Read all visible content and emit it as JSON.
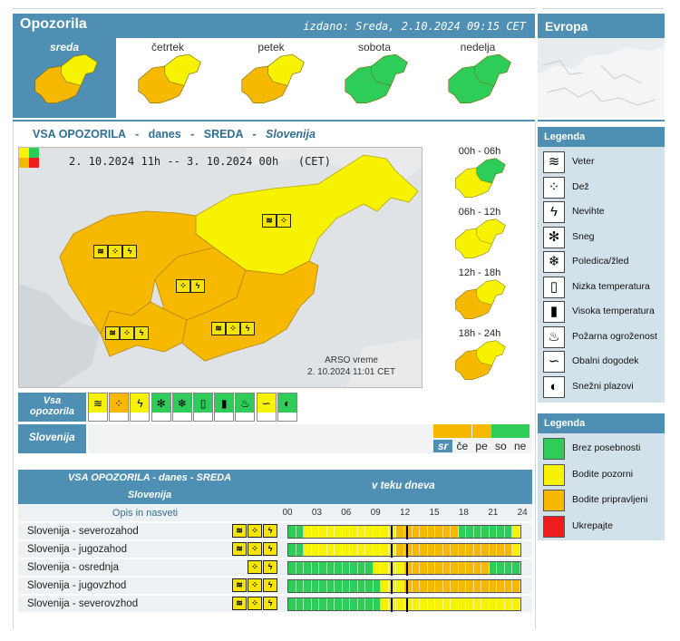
{
  "header": {
    "title": "Opozorila",
    "issued": "izdano: Sreda, 2.10.2024 09:15 CET",
    "europe": "Evropa"
  },
  "days": [
    {
      "label": "sreda",
      "selected": true
    },
    {
      "label": "četrtek",
      "selected": false
    },
    {
      "label": "petek",
      "selected": false
    },
    {
      "label": "sobota",
      "selected": false
    },
    {
      "label": "nedelja",
      "selected": false
    }
  ],
  "main": {
    "subtitle_a": "VSA OPOZORILA",
    "dash": "-",
    "subtitle_b": "danes",
    "subtitle_c": "SREDA",
    "subtitle_d": "Slovenija",
    "time_range": "2. 10.2024 11h -- 3. 10.2024 00h   (CET)",
    "credit_1": "ARSO vreme",
    "credit_2": "2. 10.2024  11:01 CET"
  },
  "periods": [
    {
      "label": "00h - 06h",
      "level": "green"
    },
    {
      "label": "06h - 12h",
      "level": "yellow"
    },
    {
      "label": "12h - 18h",
      "level": "orange"
    },
    {
      "label": "18h - 24h",
      "level": "orange"
    }
  ],
  "type_row": {
    "title_1": "Vsa",
    "title_2": "opozorila",
    "region": "Slovenija",
    "icons": [
      "wind-icon",
      "rain-icon",
      "thunderstorm-icon",
      "snow-icon",
      "ice-icon",
      "low-temp-icon",
      "high-temp-icon",
      "fire-icon",
      "coastal-icon",
      "avalanche-icon"
    ],
    "levels": [
      "yellow",
      "orange",
      "yellow",
      "green",
      "green",
      "green",
      "green",
      "green",
      "yellow",
      "green"
    ]
  },
  "day_select": {
    "labels": [
      "sr",
      "če",
      "pe",
      "so",
      "ne"
    ],
    "levels": [
      "orange",
      "orange",
      "orange",
      "green",
      "green"
    ]
  },
  "table": {
    "title_1": "VSA OPOZORILA - danes - SREDA",
    "title_2": "Slovenija",
    "timeline_title": "v teku dneva",
    "desc_col": "Opis in nasveti",
    "hours": [
      "00",
      "03",
      "06",
      "09",
      "12",
      "15",
      "18",
      "21",
      "24"
    ],
    "rows": [
      {
        "name": "Slovenija - severozahod",
        "icons": [
          "wind",
          "rain",
          "thunder"
        ],
        "segs": [
          "green",
          "green",
          "yellow",
          "yellow",
          "yellow",
          "yellow",
          "yellow",
          "yellow",
          "yellow",
          "yellow",
          "yellow",
          "yellow",
          "yellow",
          "yellow",
          "orange",
          "orange",
          "orange",
          "orange",
          "orange",
          "orange",
          "orange",
          "orange",
          "green",
          "green",
          "green",
          "green",
          "green",
          "green",
          "green",
          "yellow"
        ]
      },
      {
        "name": "Slovenija - jugozahod",
        "icons": [
          "wind",
          "rain",
          "thunder"
        ],
        "segs": [
          "green",
          "green",
          "yellow",
          "yellow",
          "yellow",
          "yellow",
          "yellow",
          "yellow",
          "yellow",
          "yellow",
          "yellow",
          "yellow",
          "yellow",
          "yellow",
          "orange",
          "orange",
          "orange",
          "orange",
          "orange",
          "orange",
          "orange",
          "orange",
          "orange",
          "orange",
          "orange",
          "orange",
          "orange",
          "orange",
          "orange",
          "yellow"
        ]
      },
      {
        "name": "Slovenija - osrednja",
        "icons": [
          "rain",
          "thunder"
        ],
        "segs": [
          "green",
          "green",
          "green",
          "green",
          "green",
          "green",
          "green",
          "green",
          "green",
          "green",
          "green",
          "yellow",
          "yellow",
          "yellow",
          "yellow",
          "orange",
          "orange",
          "orange",
          "orange",
          "orange",
          "orange",
          "orange",
          "orange",
          "orange",
          "orange",
          "orange",
          "green",
          "green",
          "green",
          "green"
        ]
      },
      {
        "name": "Slovenija - jugovzhod",
        "icons": [
          "wind",
          "rain",
          "thunder"
        ],
        "segs": [
          "green",
          "green",
          "green",
          "green",
          "green",
          "green",
          "green",
          "green",
          "green",
          "green",
          "green",
          "green",
          "yellow",
          "yellow",
          "yellow",
          "orange",
          "orange",
          "orange",
          "orange",
          "orange",
          "orange",
          "orange",
          "orange",
          "orange",
          "orange",
          "orange",
          "orange",
          "orange",
          "orange",
          "orange"
        ]
      },
      {
        "name": "Slovenija - severovzhod",
        "icons": [
          "wind",
          "rain",
          "thunder"
        ],
        "segs": [
          "green",
          "green",
          "green",
          "green",
          "green",
          "green",
          "green",
          "green",
          "green",
          "green",
          "green",
          "green",
          "yellow",
          "yellow",
          "yellow",
          "yellow",
          "yellow",
          "yellow",
          "yellow",
          "yellow",
          "yellow",
          "yellow",
          "yellow",
          "yellow",
          "yellow",
          "yellow",
          "yellow",
          "yellow",
          "yellow",
          "yellow"
        ]
      }
    ]
  },
  "legend": {
    "title": "Legenda",
    "items": [
      "Veter",
      "Dež",
      "Nevihte",
      "Sneg",
      "Poledica/žled",
      "Nizka temperatura",
      "Visoka temperatura",
      "Požarna ogroženost",
      "Obalni dogodek",
      "Snežni plazovi"
    ],
    "icons": [
      "wind-icon",
      "rain-icon",
      "thunderstorm-icon",
      "snow-icon",
      "ice-icon",
      "low-temp-icon",
      "high-temp-icon",
      "fire-icon",
      "coastal-icon",
      "avalanche-icon"
    ],
    "title2": "Legenda",
    "levels": [
      {
        "label": "Brez posebnosti",
        "color": "#2ecc59"
      },
      {
        "label": "Bodite pozorni",
        "color": "#f7f300"
      },
      {
        "label": "Bodite pripravljeni",
        "color": "#f7b900"
      },
      {
        "label": "Ukrepajte",
        "color": "#ee1c1c"
      }
    ]
  },
  "colors": {
    "green": "#2ecc59",
    "yellow": "#f7f300",
    "orange": "#f7b900",
    "red": "#ee1c1c",
    "accent": "#4e8fb3"
  }
}
